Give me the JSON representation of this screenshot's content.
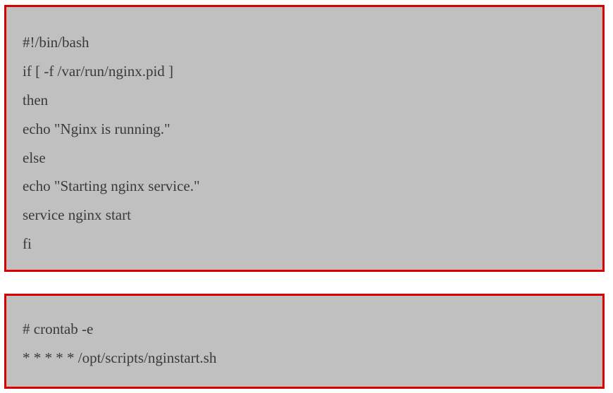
{
  "blocks": [
    {
      "lines": [
        "#!/bin/bash",
        "if [ -f /var/run/nginx.pid ]",
        "then",
        "echo \"Nginx is running.\"",
        "else",
        "echo \"Starting nginx service.\"",
        "service nginx start",
        "fi"
      ]
    },
    {
      "lines": [
        "# crontab -e",
        "* * * * * /opt/scripts/nginstart.sh"
      ]
    }
  ],
  "colors": {
    "box_background": "#c1c0c1",
    "box_border": "#d90000",
    "text": "#3a3a3a"
  }
}
